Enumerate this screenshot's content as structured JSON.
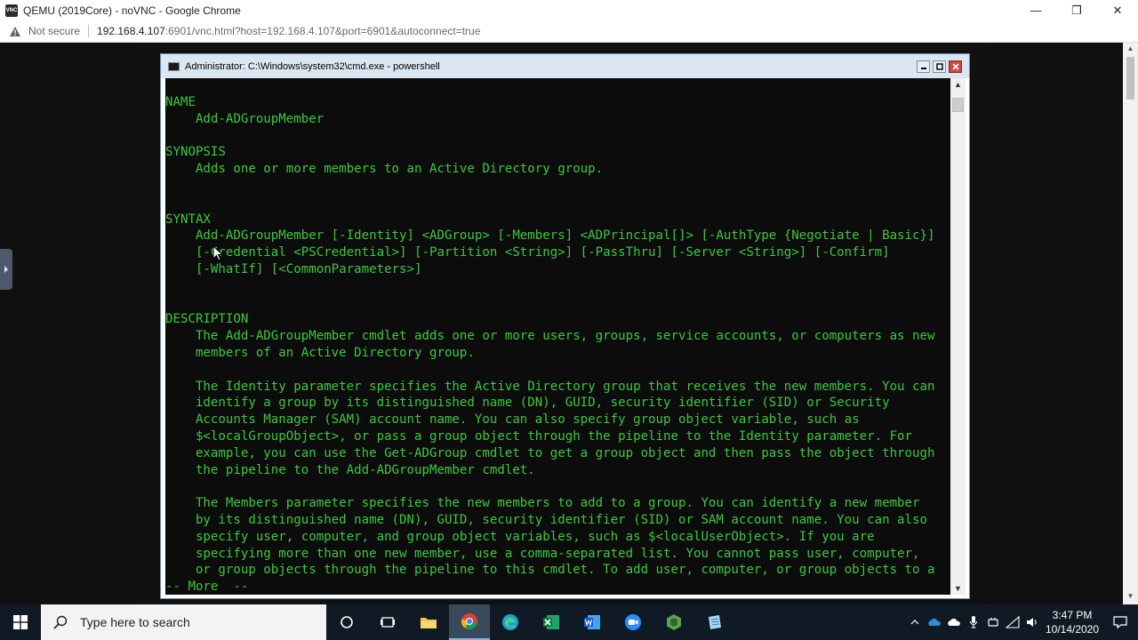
{
  "browser": {
    "app_icon_text": "VNC",
    "window_title": "QEMU (2019Core) - noVNC - Google Chrome",
    "security_label": "Not secure",
    "url_host": "192.168.4.107",
    "url_rest": ":6901/vnc.html?host=192.168.4.107&port=6901&autoconnect=true",
    "controls": {
      "minimize": "—",
      "maximize": "❐",
      "close": "✕"
    }
  },
  "cmd": {
    "title": "Administrator: C:\\Windows\\system32\\cmd.exe - powershell",
    "lines": [
      "NAME",
      "    Add-ADGroupMember",
      "",
      "SYNOPSIS",
      "    Adds one or more members to an Active Directory group.",
      "",
      "",
      "SYNTAX",
      "    Add-ADGroupMember [-Identity] <ADGroup> [-Members] <ADPrincipal[]> [-AuthType {Negotiate | Basic}]",
      "    [-Credential <PSCredential>] [-Partition <String>] [-PassThru] [-Server <String>] [-Confirm]",
      "    [-WhatIf] [<CommonParameters>]",
      "",
      "",
      "DESCRIPTION",
      "    The Add-ADGroupMember cmdlet adds one or more users, groups, service accounts, or computers as new",
      "    members of an Active Directory group.",
      "",
      "    The Identity parameter specifies the Active Directory group that receives the new members. You can",
      "    identify a group by its distinguished name (DN), GUID, security identifier (SID) or Security",
      "    Accounts Manager (SAM) account name. You can also specify group object variable, such as",
      "    $<localGroupObject>, or pass a group object through the pipeline to the Identity parameter. For",
      "    example, you can use the Get-ADGroup cmdlet to get a group object and then pass the object through",
      "    the pipeline to the Add-ADGroupMember cmdlet.",
      "",
      "    The Members parameter specifies the new members to add to a group. You can identify a new member",
      "    by its distinguished name (DN), GUID, security identifier (SID) or SAM account name. You can also",
      "    specify user, computer, and group object variables, such as $<localUserObject>. If you are",
      "    specifying more than one new member, use a comma-separated list. You cannot pass user, computer,",
      "    or group objects through the pipeline to this cmdlet. To add user, computer, or group objects to a",
      "-- More  --"
    ],
    "colors": {
      "text": "#3bc83b",
      "background": "#0c0c0c"
    }
  },
  "taskbar": {
    "search_placeholder": "Type here to search",
    "apps": [
      "task-view",
      "file-explorer",
      "chrome",
      "edge",
      "excel",
      "word",
      "zoom",
      "node",
      "notepad"
    ],
    "clock_time": "3:47 PM",
    "clock_date": "10/14/2020"
  }
}
